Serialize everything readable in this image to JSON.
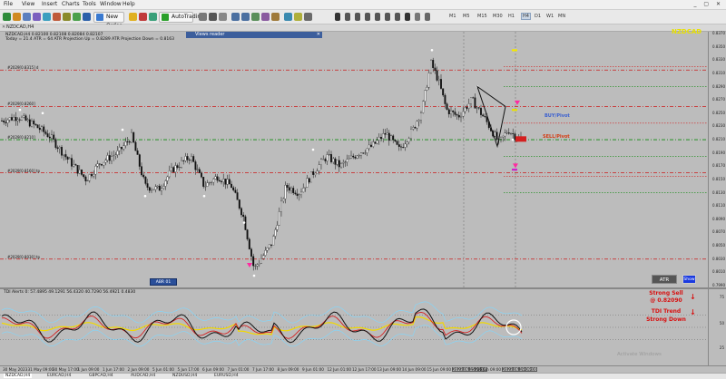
{
  "menu": [
    "File",
    "View",
    "Insert",
    "Charts",
    "Tools",
    "Window",
    "Help"
  ],
  "toolbar": {
    "new_order": "New Order",
    "autotrading": "AutoTrading",
    "timeframes": [
      "M1",
      "M5",
      "M15",
      "M30",
      "H1",
      "H4",
      "D1",
      "W1",
      "MN"
    ],
    "active_timeframe": "H4"
  },
  "chart": {
    "tab_title": "NZDCAD,H4",
    "info_line1": "NZDCAD,H4  0.82100 0.82108 0.82084 0.82107",
    "info_line2": "Today = 21.4    ATR = 64    ATR Projection Up = 0.8289    ATR Projection Down = 0.8163",
    "symbol": "NZDCAD",
    "news_reader": "Views reader",
    "buy_pivot": "BUY/Pivot",
    "sell_pivot": "SELL/Pivot",
    "atr_btn": "ATR",
    "show_btn": "Show",
    "dates_btn": "ABR 01",
    "current_price": "0.82107",
    "level_labels": [
      {
        "text": "#2029[0.8315] d",
        "price": 0.8315,
        "color": "#cc1a1a"
      },
      {
        "text": "#2029[0.8260]",
        "price": 0.826,
        "color": "#cc1a1a"
      },
      {
        "text": "#2029[0.8210]",
        "price": 0.821,
        "color": "#0e8a0e"
      },
      {
        "text": "#2029[0.8160] tp",
        "price": 0.816,
        "color": "#cc1a1a"
      },
      {
        "text": "#2029[0.8030] tp",
        "price": 0.803,
        "color": "#cc1a1a"
      },
      {
        "text": "#2029[0.7930] tp",
        "price": 0.793,
        "color": "#cc1a1a"
      }
    ]
  },
  "price_axis": [
    "0.8370",
    "0.8360",
    "0.8350",
    "0.8340",
    "0.8330",
    "0.8320",
    "0.8310",
    "0.8300",
    "0.8290",
    "0.8280",
    "0.8270",
    "0.8260",
    "0.8250",
    "0.8240",
    "0.8230",
    "0.8220",
    "0.8210",
    "0.8200",
    "0.8190",
    "0.8180",
    "0.8170",
    "0.8160",
    "0.8150",
    "0.8140",
    "0.8130",
    "0.8120",
    "0.8110",
    "0.8100",
    "0.8090",
    "0.8080",
    "0.8070",
    "0.8060",
    "0.8050",
    "0.8040",
    "0.8030",
    "0.8020",
    "0.8010",
    "0.8000",
    "0.7990"
  ],
  "tdi": {
    "info": "TDI Alerts  0: 57.4895 49.1291 56.4320 40.7290 56.4921 0.4830",
    "signal1": "Strong Sell",
    "signal1_price": "@ 0.82090",
    "signal2": "TDI Trend",
    "signal2_sub": "Strong Down",
    "axis_ticks": [
      "75",
      "50",
      "25"
    ]
  },
  "time_axis": [
    "30 May 2023",
    "31 May 09:00",
    "30 May 17:00",
    "1 Jun 09:00",
    "1 Jun 17:00",
    "2 Jun 09:00",
    "5 Jun 01:00",
    "5 Jun 17:00",
    "6 Jun 09:00",
    "7 Jun 01:00",
    "7 Jun 17:00",
    "8 Jun 09:00",
    "9 Jun 01:00",
    "12 Jun 01:00",
    "12 Jun 17:00",
    "13 Jun 09:00",
    "14 Jun 09:00",
    "15 Jun 09:00",
    "2023.06.15 21:00",
    "16 Jun 09:00",
    "2023.06.19 09:00"
  ],
  "watermark": "Activate Windows",
  "bottom_tabs": [
    "NZDCAD,H4",
    "EURCAD,H4",
    "GBPCAD,H4",
    "AUDCAD,H4",
    "NZDUSD,H4",
    "EURUSD,H4"
  ],
  "colors": {
    "bg": "#bcbcbc",
    "candle": "#111111",
    "red_line": "#d42020",
    "green_line": "#0e8a0e",
    "symbol": "#e8e000",
    "buy": "#3a5fd0",
    "sell": "#d43a10",
    "signal": "#d81010"
  }
}
